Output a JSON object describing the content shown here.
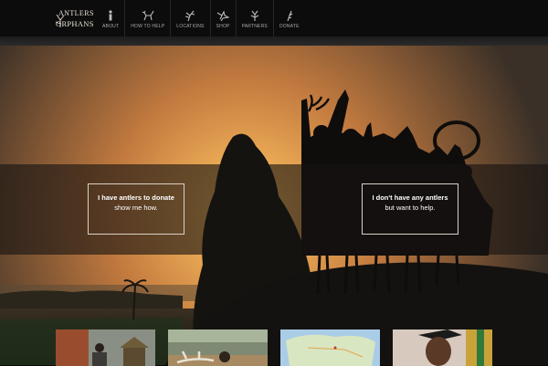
{
  "header": {
    "logo": {
      "line1": "ANTLERS",
      "line2": "ORPHANS",
      "mark": "antler-4-logo"
    },
    "nav": [
      {
        "label": "ABOUT",
        "icon": "info-icon"
      },
      {
        "label": "HOW TO HELP",
        "icon": "deer-icon"
      },
      {
        "label": "LOCATIONS",
        "icon": "antler-icon"
      },
      {
        "label": "SHOP",
        "icon": "bird-icon"
      },
      {
        "label": "PARTNERS",
        "icon": "antler-small-icon"
      },
      {
        "label": "DONATE",
        "icon": "feather-icon"
      }
    ]
  },
  "hero": {
    "cta_left": {
      "title": "I have antlers to donate",
      "sub": "show me how."
    },
    "cta_right": {
      "title": "I don't have any antlers",
      "sub": "but want to help."
    }
  },
  "thumbnails": [
    {
      "name": "village-photo"
    },
    {
      "name": "antler-photo"
    },
    {
      "name": "map-photo"
    },
    {
      "name": "graduate-photo"
    }
  ],
  "colors": {
    "sky_top": "#3b3027",
    "sky_glow": "#e8a150",
    "band": "#161412",
    "header": "#0c0c0c"
  }
}
